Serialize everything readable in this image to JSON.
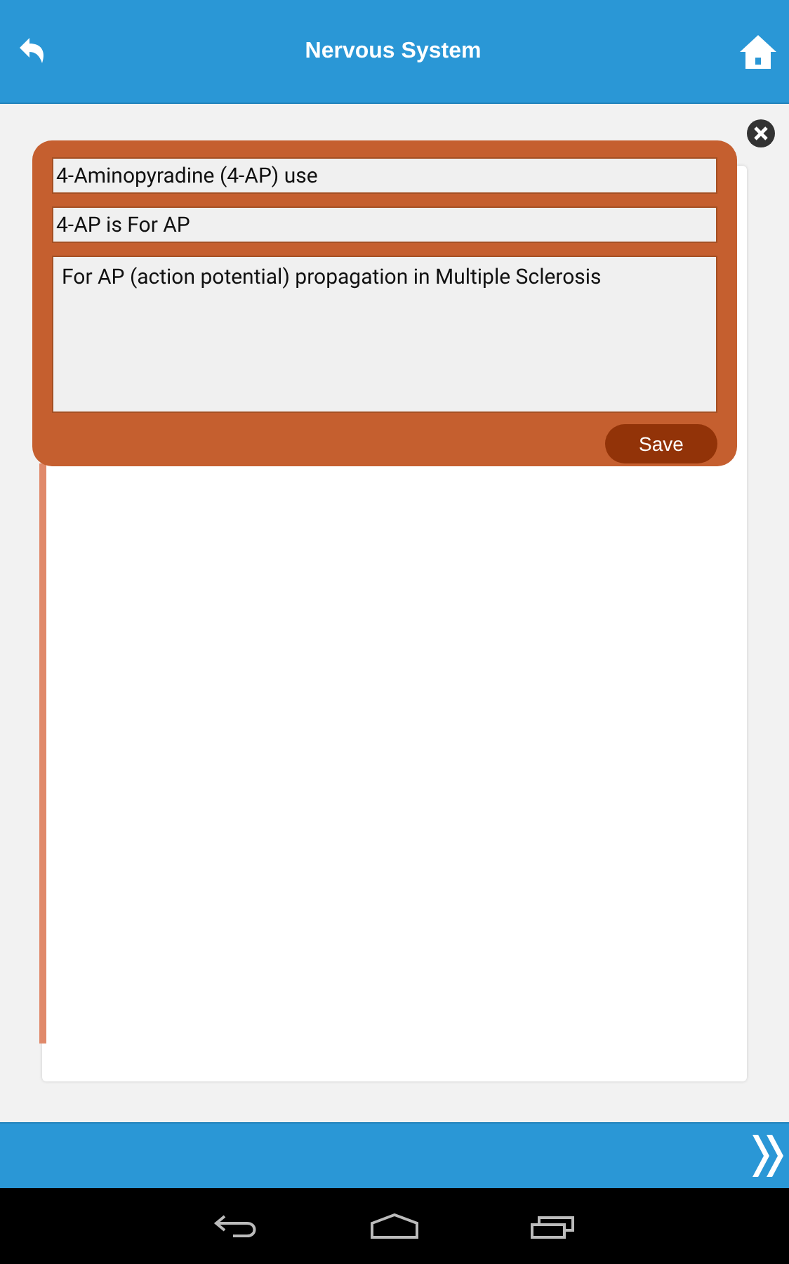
{
  "header": {
    "title": "Nervous System"
  },
  "note_editor": {
    "title_field": "4-Aminopyradine (4-AP) use",
    "subtitle_field": "4-AP is For AP",
    "body_field": "For AP (action potential) propagation in Multiple Sclerosis",
    "save_button": "Save"
  }
}
